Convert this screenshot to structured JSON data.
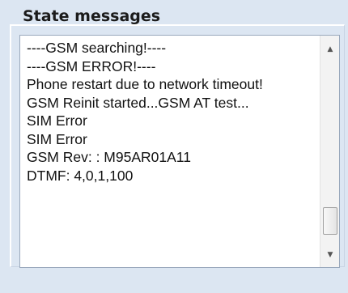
{
  "panel": {
    "title": "State messages"
  },
  "messages": [
    "----GSM searching!----",
    "----GSM ERROR!----",
    "Phone restart due to network timeout!",
    "GSM Reinit started...GSM AT test...",
    "SIM Error",
    "SIM Error",
    "GSM Rev: : M95AR01A11",
    "DTMF:  4,0,1,100"
  ],
  "scrollbar": {
    "up_icon": "scroll-up-arrow",
    "down_icon": "scroll-down-arrow",
    "up_glyph": "▲",
    "down_glyph": "▼",
    "position_fraction": 0.95
  }
}
